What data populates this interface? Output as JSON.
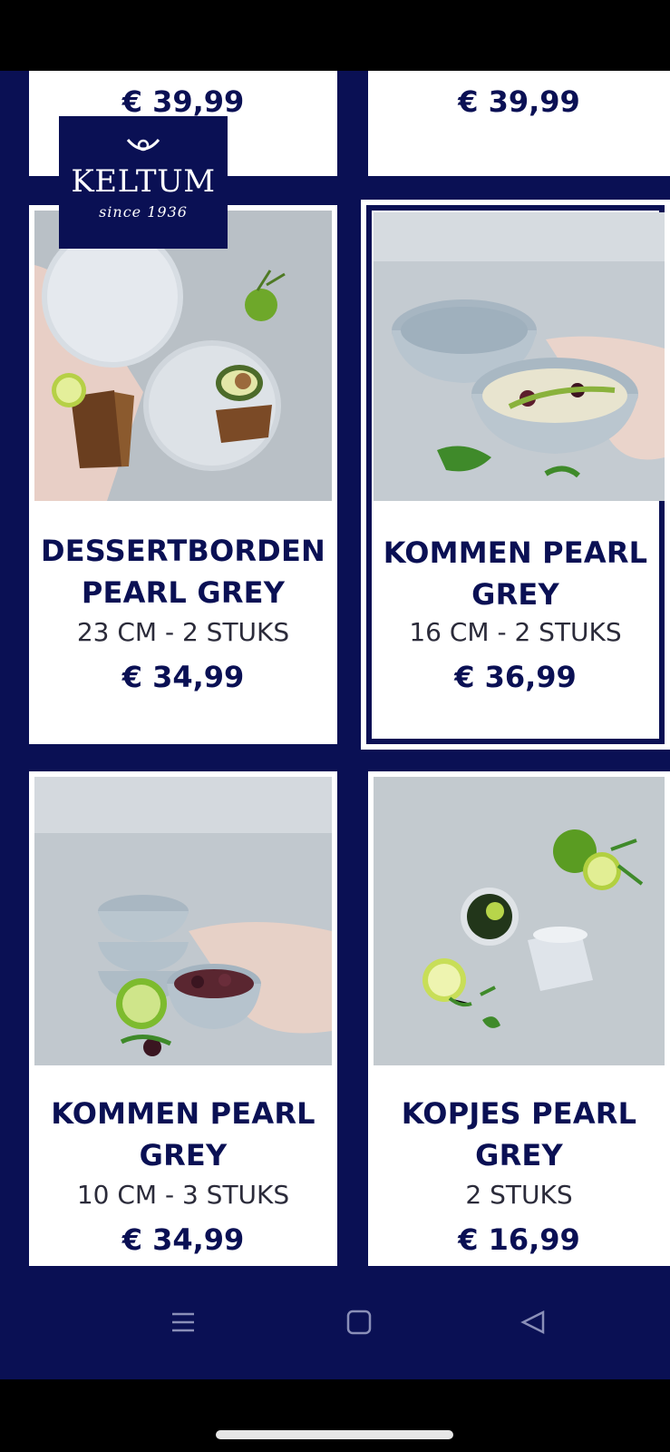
{
  "brand": {
    "name": "KELTUM",
    "tagline": "since 1936"
  },
  "partial_prices": [
    "€ 39,99",
    "€ 39,99"
  ],
  "products": [
    {
      "title_line1": "DESSERTBORDEN",
      "title_line2": "PEARL GREY",
      "size": "23 CM - 2 STUKS",
      "price": "€ 34,99"
    },
    {
      "title_line1": "KOMMEN PEARL",
      "title_line2": "GREY",
      "size": "16 CM - 2 STUKS",
      "price": "€ 36,99"
    },
    {
      "title_line1": "KOMMEN PEARL",
      "title_line2": "GREY",
      "size": "10 CM - 3 STUKS",
      "price": "€ 34,99"
    },
    {
      "title_line1": "KOPJES PEARL",
      "title_line2": "GREY",
      "size": "2 STUKS",
      "price": "€ 16,99"
    }
  ],
  "icons": {
    "menu": "hamburger-icon",
    "home": "square-icon",
    "back": "triangle-back-icon"
  },
  "colors": {
    "navy": "#0a1054",
    "card": "#ffffff",
    "lime": "#7dbb2e"
  }
}
